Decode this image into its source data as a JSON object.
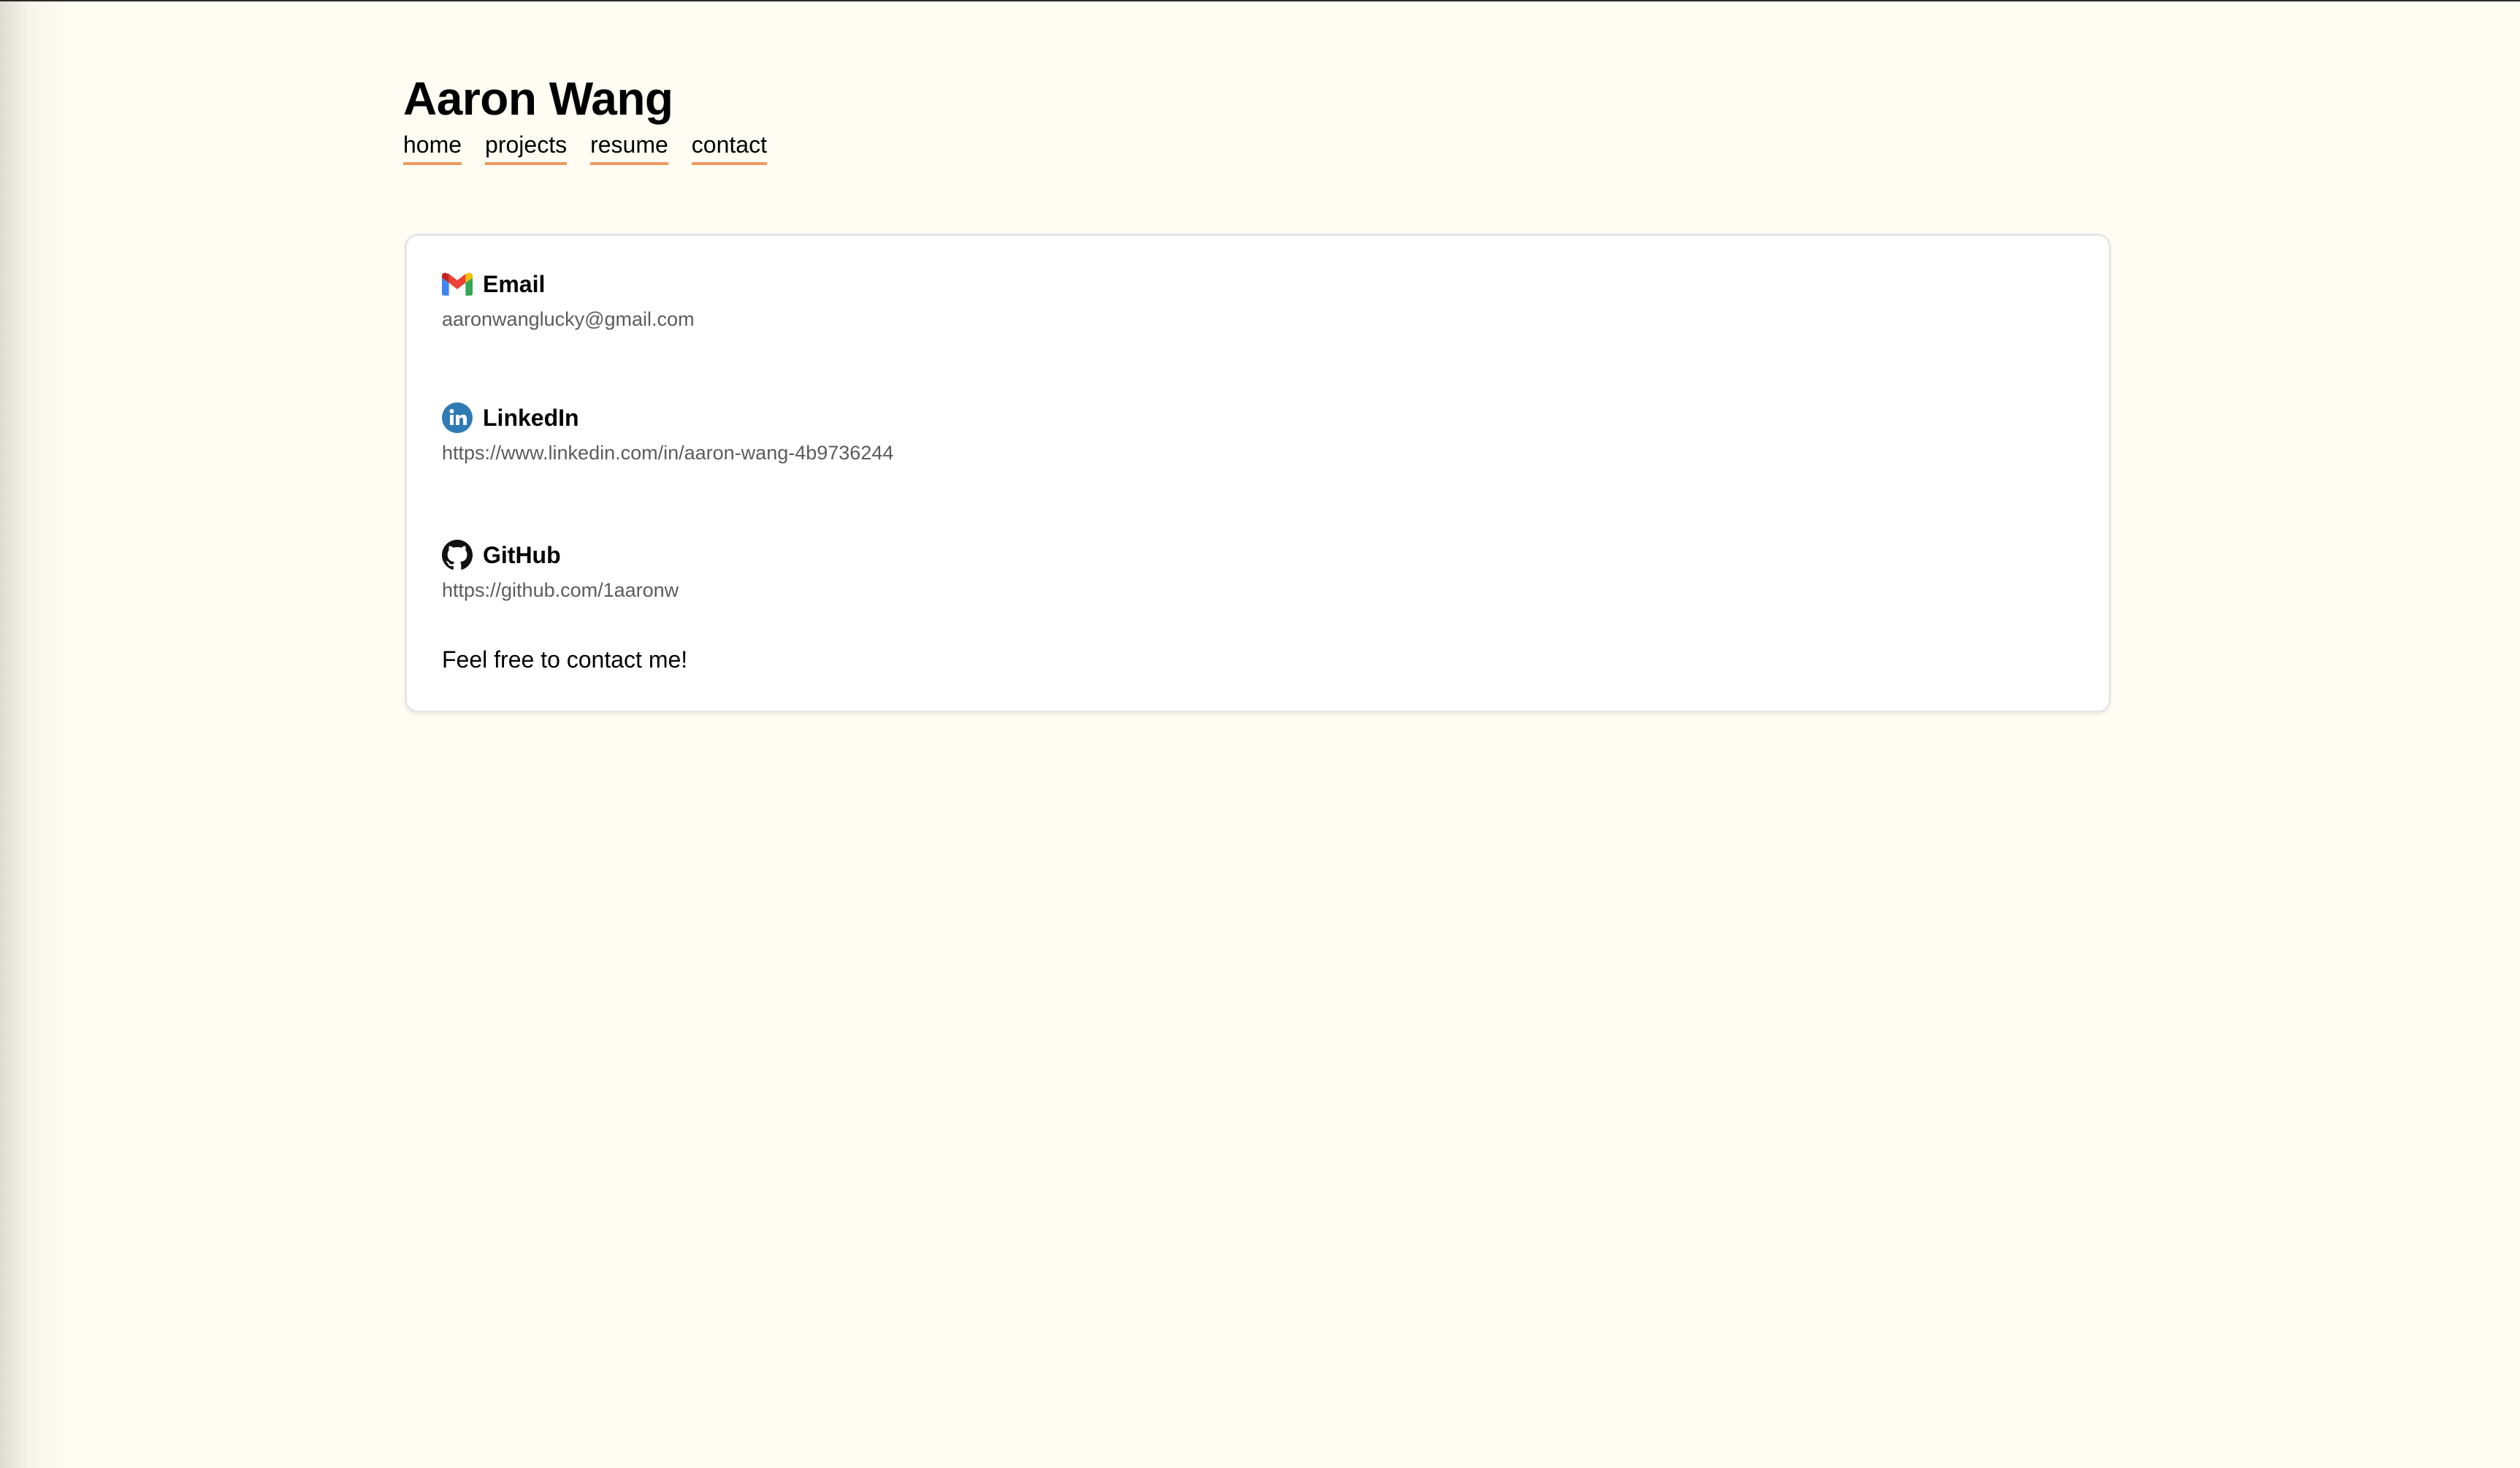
{
  "site": {
    "title": "Aaron Wang"
  },
  "nav": {
    "items": [
      {
        "label": "home"
      },
      {
        "label": "projects"
      },
      {
        "label": "resume"
      },
      {
        "label": "contact"
      }
    ],
    "underline_color": "#ee9a5f"
  },
  "contact": {
    "email": {
      "label": "Email",
      "value": "aaronwanglucky@gmail.com",
      "icon": "gmail-icon"
    },
    "linkedin": {
      "label": "LinkedIn",
      "value": "https://www.linkedin.com/in/aaron-wang-4b9736244",
      "icon": "linkedin-icon",
      "color": "#2d7ab5"
    },
    "github": {
      "label": "GitHub",
      "value": "https://github.com/1aaronw",
      "icon": "github-icon"
    },
    "footer": "Feel free to contact me!"
  },
  "colors": {
    "background": "#fffcf3",
    "card": "#ffffff",
    "muted_text": "#5c5c5c"
  }
}
